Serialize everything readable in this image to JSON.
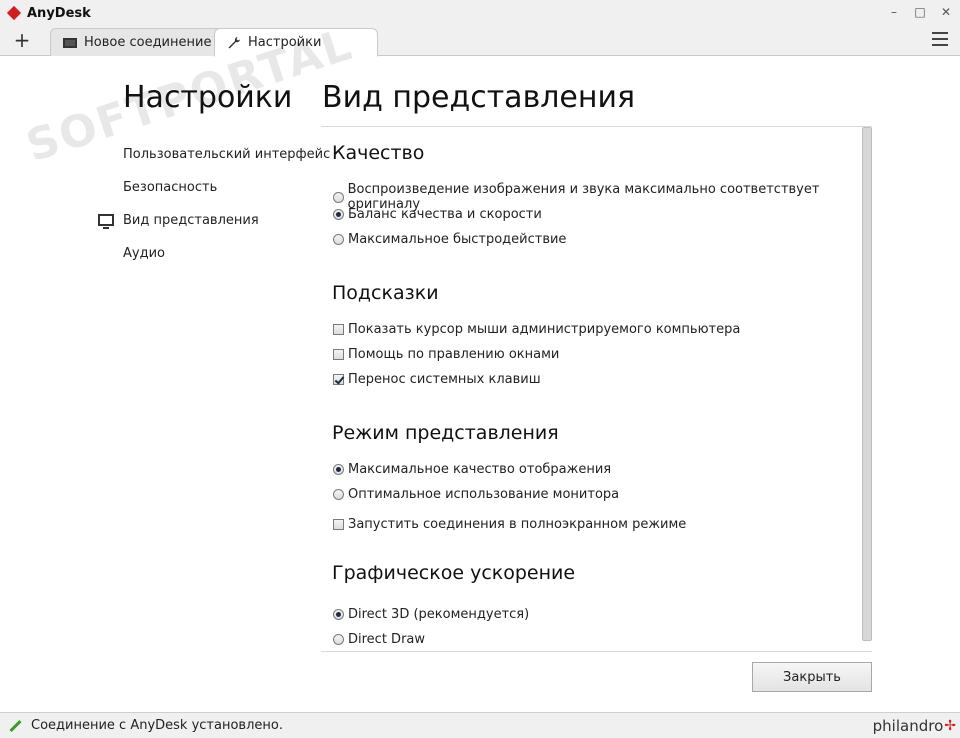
{
  "window": {
    "title": "AnyDesk",
    "minimize": "–",
    "maximize": "□",
    "close": "✕"
  },
  "tabs": [
    {
      "label": "Новое соединение",
      "icon": "monitor-icon"
    },
    {
      "label": "Настройки",
      "icon": "wrench-icon"
    }
  ],
  "watermark": "SOFTPORTAL",
  "sidebar": {
    "title": "Настройки",
    "items": [
      {
        "label": "Пользовательский интерфейс"
      },
      {
        "label": "Безопасность"
      },
      {
        "label": "Вид представления",
        "active": true,
        "icon": "monitor-icon"
      },
      {
        "label": "Аудио"
      }
    ]
  },
  "main": {
    "title": "Вид представления",
    "sections": [
      {
        "title": "Качество",
        "options": [
          {
            "type": "radio",
            "label": "Воспроизведение изображения и звука максимально соответствует оригиналу",
            "checked": false
          },
          {
            "type": "radio",
            "label": "Баланс качества и скорости",
            "checked": true
          },
          {
            "type": "radio",
            "label": "Максимальное быстродействие",
            "checked": false
          }
        ]
      },
      {
        "title": "Подсказки",
        "options": [
          {
            "type": "checkbox",
            "label": "Показать курсор мыши администрируемого компьютера",
            "checked": false
          },
          {
            "type": "checkbox",
            "label": "Помощь по правлению окнами",
            "checked": false
          },
          {
            "type": "checkbox",
            "label": "Перенос системных клавиш",
            "checked": true
          }
        ]
      },
      {
        "title": "Режим представления",
        "options": [
          {
            "type": "radio",
            "label": "Максимальное качество отображения",
            "checked": true
          },
          {
            "type": "radio",
            "label": "Оптимальное использование монитора",
            "checked": false
          },
          {
            "type": "checkbox",
            "label": "Запустить соединения в полноэкранном режиме",
            "checked": false
          }
        ]
      },
      {
        "title": "Графическое ускорение",
        "options": [
          {
            "type": "radio",
            "label": "Direct 3D (рекомендуется)",
            "checked": true
          },
          {
            "type": "radio",
            "label": "Direct Draw",
            "checked": false
          }
        ]
      }
    ],
    "close_label": "Закрыть"
  },
  "status": {
    "text": "Соединение с AnyDesk установлено.",
    "brand": "philandro",
    "brand_mark": "✢"
  }
}
